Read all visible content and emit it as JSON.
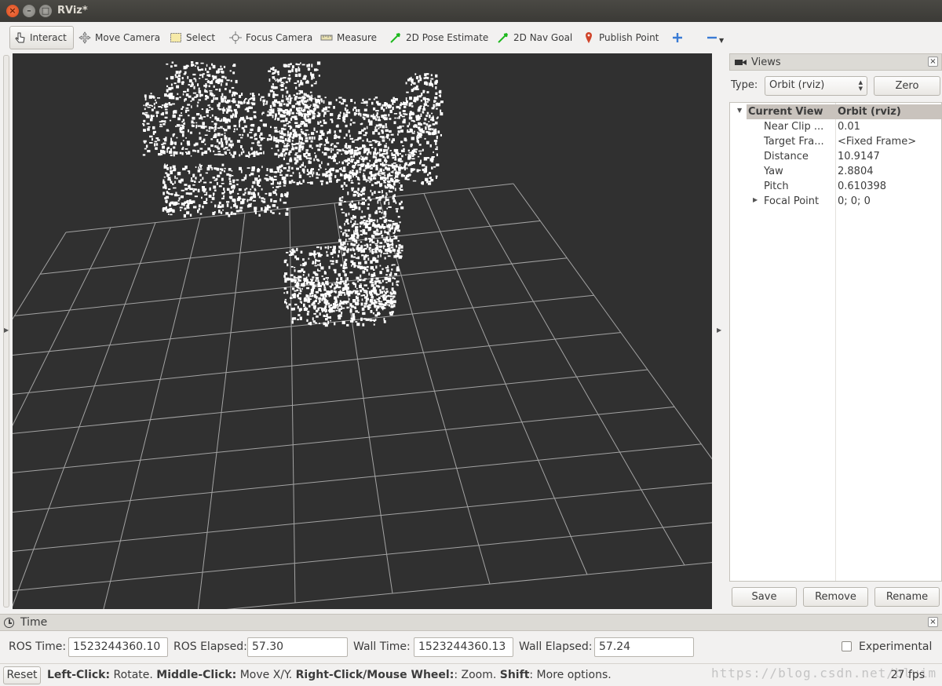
{
  "window": {
    "title": "RViz*"
  },
  "toolbar": {
    "tools": [
      {
        "label": "Interact",
        "icon": "hand-pointer-icon"
      },
      {
        "label": "Move Camera",
        "icon": "move-arrows-icon"
      },
      {
        "label": "Select",
        "icon": "select-rectangle-icon"
      },
      {
        "label": "Focus Camera",
        "icon": "focus-crosshair-icon"
      },
      {
        "label": "Measure",
        "icon": "ruler-icon"
      },
      {
        "label": "2D Pose Estimate",
        "icon": "green-arrow-icon"
      },
      {
        "label": "2D Nav Goal",
        "icon": "green-arrow-icon"
      },
      {
        "label": "Publish Point",
        "icon": "map-pin-icon"
      }
    ],
    "add_icon": "plus-icon",
    "remove_icon": "minus-icon"
  },
  "views": {
    "title": "Views",
    "type_label": "Type:",
    "type_value": "Orbit (rviz)",
    "zero_label": "Zero",
    "current_view": {
      "key": "Current View",
      "value": "Orbit (rviz)"
    },
    "properties": [
      {
        "key": "Near Clip ...",
        "value": "0.01"
      },
      {
        "key": "Target Fra...",
        "value": "<Fixed Frame>"
      },
      {
        "key": "Distance",
        "value": "10.9147"
      },
      {
        "key": "Yaw",
        "value": "2.8804"
      },
      {
        "key": "Pitch",
        "value": "0.610398"
      },
      {
        "key": "Focal Point",
        "value": "0; 0; 0"
      }
    ],
    "save_label": "Save",
    "remove_label": "Remove",
    "rename_label": "Rename"
  },
  "time": {
    "title": "Time",
    "ros_time_label": "ROS Time:",
    "ros_time": "1523244360.10",
    "ros_elapsed_label": "ROS Elapsed:",
    "ros_elapsed": "57.30",
    "wall_time_label": "Wall Time:",
    "wall_time": "1523244360.13",
    "wall_elapsed_label": "Wall Elapsed:",
    "wall_elapsed": "57.24",
    "experimental_label": "Experimental"
  },
  "status": {
    "reset_label": "Reset",
    "hint_left_click": "Left-Click:",
    "hint_rotate": " Rotate. ",
    "hint_middle_click": "Middle-Click:",
    "hint_move": " Move X/Y. ",
    "hint_right_click": "Right-Click/Mouse Wheel:",
    "hint_zoom": ": Zoom. ",
    "hint_shift": "Shift",
    "hint_more": ": More options.",
    "fps": "27 fps",
    "watermark": "https://blog.csdn.net/bluim"
  },
  "colors": {
    "viewport_bg": "#303030",
    "grid_line": "#a0a0a0",
    "point_cloud": "#ffffff",
    "header_row": "#c9c3bd"
  }
}
